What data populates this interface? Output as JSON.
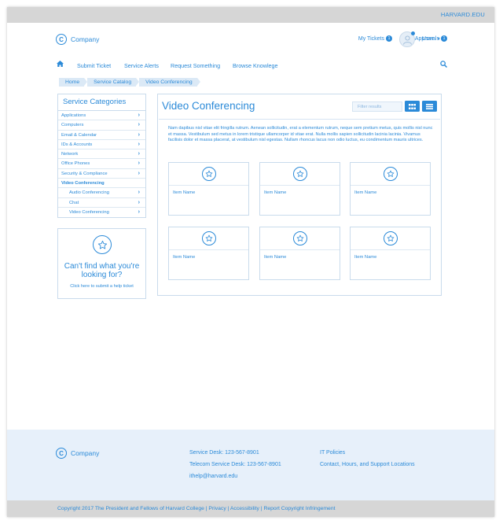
{
  "topbar": {
    "harvard_link": "HARVARD.EDU"
  },
  "header": {
    "logo_letter": "C",
    "company": "Company",
    "my_tickets": "My Tickets",
    "my_tickets_count": "1",
    "my_approvals": "My Approvals",
    "my_approvals_count": "1",
    "user": "User"
  },
  "nav": {
    "items": [
      "Submit Ticket",
      "Service Alerts",
      "Request Something",
      "Browse Knowlege"
    ]
  },
  "breadcrumb": [
    "Home",
    "Service Catalog",
    "Video Conferencing"
  ],
  "sidebar": {
    "title": "Service Categories",
    "items": [
      "Applications",
      "Computers",
      "Email & Calendar",
      "IDs & Accounts",
      "Network",
      "Office Phones",
      "Security & Compliance",
      "Video Conferencing",
      "Audio Conferencing",
      "Chat",
      "Video Conferencing"
    ]
  },
  "help": {
    "title": "Can't find what you're looking for?",
    "subtitle": "Click here to submit a help ticket"
  },
  "main": {
    "title": "Video Conferencing",
    "filter_placeholder": "Filter results",
    "description": "Nam dapibus nisl vitae elit fringilla rutrum. Aenean sollicitudin, erat a elementum rutrum, neque sem pretium metus, quis mollis nisl nunc et massa. Vestibulum sed metus in lorem tristique ullamcorper id vitae erat. Nulla mollis sapien sollicitudin lacinia lacinia. Vivamus facilisis dolor et massa placerat, at vestibulum nisl egestas. Nullam rhoncus lacus non odio luctus, eu condimentum mauris ultrices.",
    "items": [
      "Item Name",
      "Item Name",
      "Item Name",
      "Item Name",
      "Item Name",
      "Item Name"
    ]
  },
  "footer": {
    "company": "Company",
    "service_desk": "Service Desk: 123-567-8901",
    "telecom_desk": "Telecom Service Desk: 123-567-8901",
    "email": "ithelp@harvard.edu",
    "it_policies": "IT Policies",
    "contact": "Contact, Hours, and Support Locations",
    "copyright": "Copyright 2017 The President and Fellows of Harvard College | Privacy | Accessibility | Report Copyright Infringement"
  },
  "colors": {
    "accent": "#2b8ad8",
    "footer_bg": "#e7f0fa",
    "topbar_bg": "#d6d6d6"
  }
}
